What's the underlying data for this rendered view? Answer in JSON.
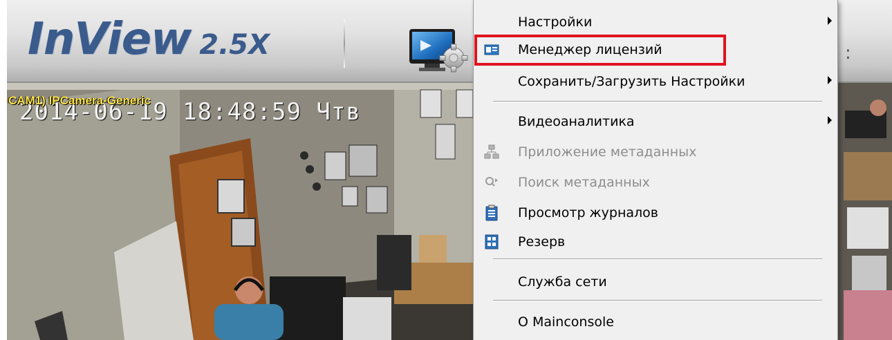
{
  "app": {
    "logo_name": "InView",
    "logo_version": "2.5X",
    "header_stub": ":"
  },
  "video": {
    "camera_label": "CAM1) IPCamera-Generic",
    "osd_timestamp": "2014-06-19 18:48:59 Чтв"
  },
  "menu": {
    "items": [
      {
        "label": "Настройки",
        "submenu": true,
        "disabled": false,
        "icon": null
      },
      {
        "label": "Менеджер лицензий",
        "submenu": false,
        "disabled": false,
        "icon": "license-card-icon",
        "highlighted": true
      },
      {
        "label": "Сохранить/Загрузить Настройки",
        "submenu": true,
        "disabled": false,
        "icon": null
      },
      {
        "label": "Видеоаналитика",
        "submenu": true,
        "disabled": false,
        "icon": null
      },
      {
        "label": "Приложение метаданных",
        "submenu": false,
        "disabled": true,
        "icon": "network-tree-icon"
      },
      {
        "label": "Поиск метаданных",
        "submenu": false,
        "disabled": true,
        "icon": "search-arrow-icon"
      },
      {
        "label": "Просмотр журналов",
        "submenu": false,
        "disabled": false,
        "icon": "clipboard-icon"
      },
      {
        "label": "Резерв",
        "submenu": false,
        "disabled": false,
        "icon": "backup-grid-icon"
      },
      {
        "label": "Служба сети",
        "submenu": false,
        "disabled": false,
        "icon": null
      },
      {
        "label": "О Mainconsole",
        "submenu": false,
        "disabled": false,
        "icon": null
      }
    ]
  },
  "colors": {
    "highlight_border": "#e0141f",
    "logo_blue": "#3a5b8c",
    "camera_label": "#ffe54a"
  }
}
